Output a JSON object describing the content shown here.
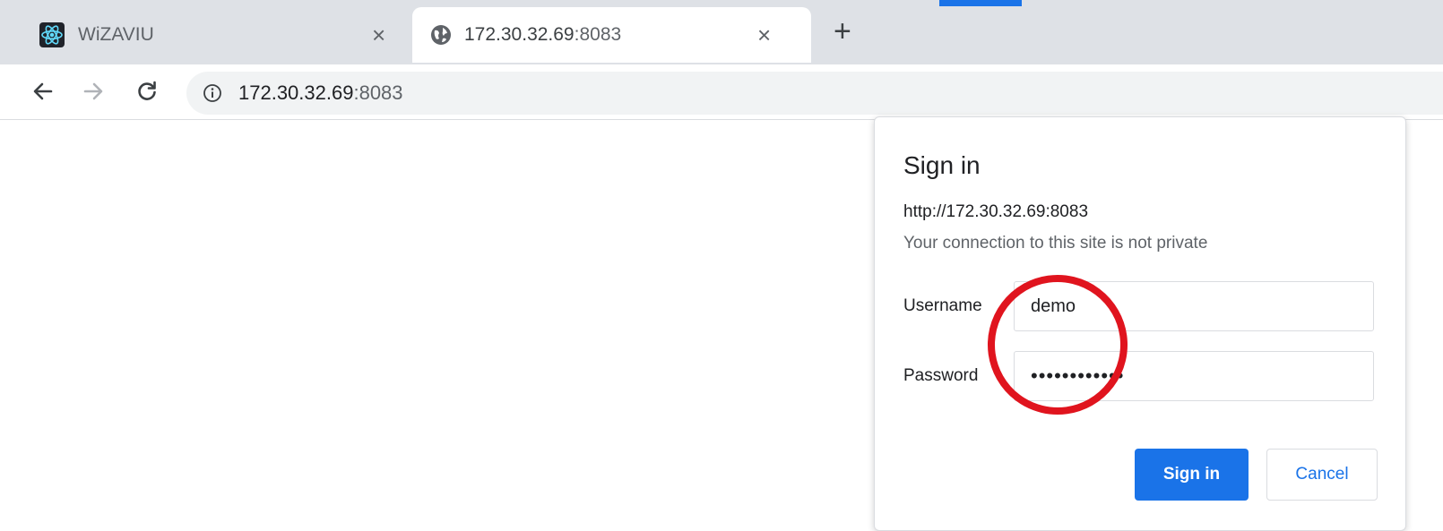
{
  "browser": {
    "tabs": [
      {
        "title": "WiZAVIU",
        "icon": "react-logo-icon",
        "active": false
      },
      {
        "title_host": "172.30.32.69",
        "title_port": ":8083",
        "icon": "globe-icon",
        "active": true
      }
    ],
    "close_glyph": "×",
    "new_tab_glyph": "+",
    "omnibox": {
      "host": "172.30.32.69",
      "port": ":8083",
      "icon": "info-icon"
    }
  },
  "dialog": {
    "title": "Sign in",
    "url": "http://172.30.32.69:8083",
    "warning": "Your connection to this site is not private",
    "username_label": "Username",
    "username_value": "demo",
    "password_label": "Password",
    "password_value": "demopassword",
    "sign_in_label": "Sign in",
    "cancel_label": "Cancel"
  },
  "colors": {
    "accent": "#1a73e8",
    "annotation": "#e0141e",
    "tabstrip": "#dee1e6"
  }
}
